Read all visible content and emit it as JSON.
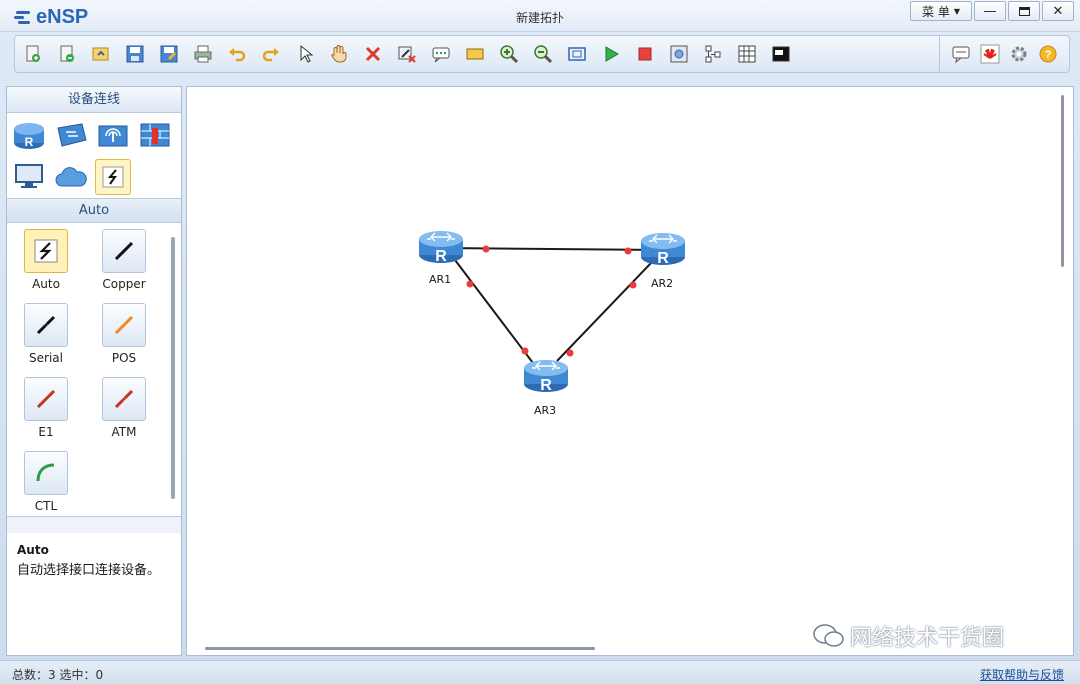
{
  "app": {
    "logo_text": "eNSP",
    "window_title": "新建拓扑",
    "menu_label": "菜 单",
    "brand_color": "#2e66b6"
  },
  "toolbar": {
    "buttons": [
      "new-topology-icon",
      "new-lab-icon",
      "open-icon",
      "save-icon",
      "save-as-icon",
      "print-icon",
      "undo-icon",
      "redo-icon",
      "select-pointer-icon",
      "hand-pan-icon",
      "delete-icon",
      "delete-connection-icon",
      "text-annotation-icon",
      "rectangle-icon",
      "zoom-in-icon",
      "zoom-out-icon",
      "fit-view-icon",
      "start-device-icon",
      "stop-device-icon",
      "capture-icon",
      "topology-icon",
      "grid-icon",
      "console-icon"
    ],
    "right_buttons": [
      "chat-icon",
      "huawei-logo-icon",
      "settings-gear-icon",
      "help-icon"
    ]
  },
  "left_panel": {
    "header": "设备连线",
    "device_categories": [
      "router-icon",
      "switch-icon",
      "wlan-icon",
      "firewall-icon",
      "pc-icon",
      "cloud-icon",
      "connection-icon"
    ],
    "subheader": "Auto",
    "cables": [
      {
        "label": "Auto",
        "color": "#111111",
        "selected": true
      },
      {
        "label": "Copper",
        "color": "#111111"
      },
      {
        "label": "Serial",
        "color": "#111111"
      },
      {
        "label": "POS",
        "color": "#f08a24"
      },
      {
        "label": "E1",
        "color": "#c8321e"
      },
      {
        "label": "ATM",
        "color": "#c8321e"
      },
      {
        "label": "CTL",
        "color": "#2e9b4a"
      }
    ],
    "description": {
      "title": "Auto",
      "text": "自动选择接口连接设备。"
    }
  },
  "topology": {
    "routers": [
      {
        "name": "AR1"
      },
      {
        "name": "AR2"
      },
      {
        "name": "AR3"
      }
    ],
    "links": [
      [
        "AR1",
        "AR2"
      ],
      [
        "AR1",
        "AR3"
      ],
      [
        "AR2",
        "AR3"
      ]
    ],
    "port_color": "#ef3b3b",
    "router_color": "#3f8bd6"
  },
  "watermark": "网络技术干货圈",
  "statusbar": {
    "left": "总数：3 选中：0",
    "right": "获取帮助与反馈"
  }
}
